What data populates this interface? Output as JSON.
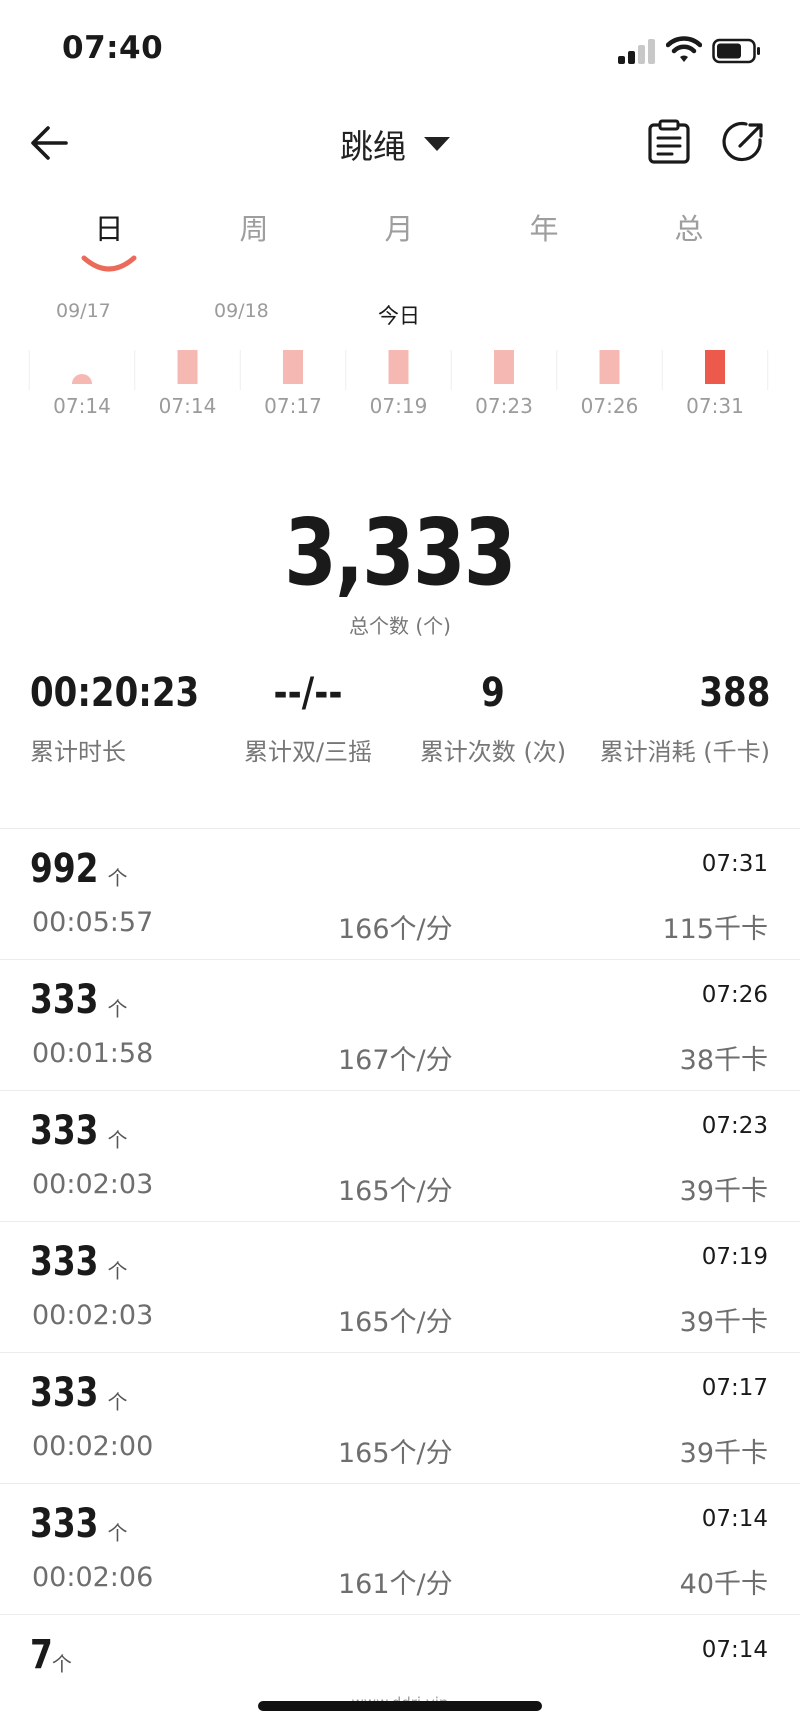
{
  "status": {
    "time": "07:40"
  },
  "nav": {
    "title": "跳绳"
  },
  "tabs": [
    {
      "label": "日",
      "active": true
    },
    {
      "label": "周",
      "active": false
    },
    {
      "label": "月",
      "active": false
    },
    {
      "label": "年",
      "active": false
    },
    {
      "label": "总",
      "active": false
    }
  ],
  "dates": [
    "09/17",
    "09/18",
    "今日"
  ],
  "chart_data": {
    "type": "bar",
    "categories": [
      "07:14",
      "07:14",
      "07:17",
      "07:19",
      "07:23",
      "07:26",
      "07:31"
    ],
    "values": [
      7,
      333,
      333,
      333,
      333,
      333,
      992
    ],
    "highlight_index": 6,
    "colors": {
      "normal": "#f5b8b2",
      "highlight": "#ec5a4c"
    }
  },
  "summary": {
    "total": "3,333",
    "total_label": "总个数 (个)",
    "duration": "00:20:23",
    "duration_label": "累计时长",
    "double": "--/--",
    "double_label": "累计双/三摇",
    "sessions": "9",
    "sessions_label": "累计次数 (次)",
    "calories": "388",
    "calories_label": "累计消耗 (千卡)"
  },
  "count_unit": "个",
  "records": [
    {
      "count": "992",
      "time": "07:31",
      "duration": "00:05:57",
      "pace": "166个/分",
      "calories": "115千卡"
    },
    {
      "count": "333",
      "time": "07:26",
      "duration": "00:01:58",
      "pace": "167个/分",
      "calories": "38千卡"
    },
    {
      "count": "333",
      "time": "07:23",
      "duration": "00:02:03",
      "pace": "165个/分",
      "calories": "39千卡"
    },
    {
      "count": "333",
      "time": "07:19",
      "duration": "00:02:03",
      "pace": "165个/分",
      "calories": "39千卡"
    },
    {
      "count": "333",
      "time": "07:17",
      "duration": "00:02:00",
      "pace": "165个/分",
      "calories": "39千卡"
    },
    {
      "count": "333",
      "time": "07:14",
      "duration": "00:02:06",
      "pace": "161个/分",
      "calories": "40千卡"
    },
    {
      "count": "7",
      "time": "07:14",
      "duration": "",
      "pace": "",
      "calories": ""
    }
  ],
  "watermark": "www.ddrj.vip"
}
